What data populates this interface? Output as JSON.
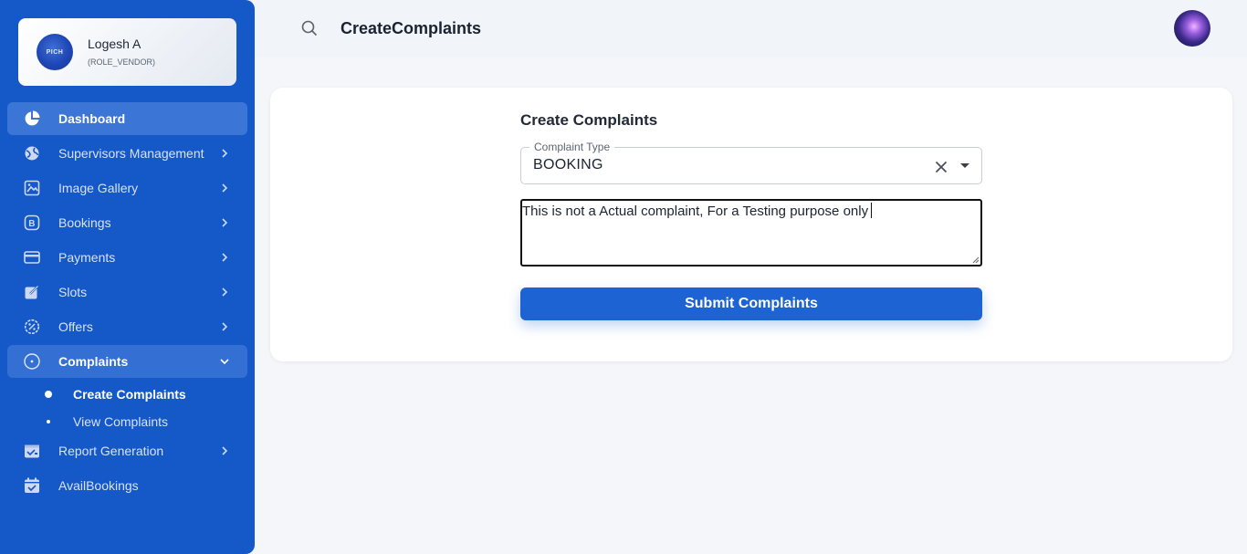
{
  "profile": {
    "name": "Logesh A",
    "role": "(ROLE_VENDOR)",
    "avatar_text": "PICH"
  },
  "sidebar": {
    "items": [
      {
        "label": "Dashboard",
        "icon": "pie-chart-icon"
      },
      {
        "label": "Supervisors Management",
        "icon": "globe-icon"
      },
      {
        "label": "Image Gallery",
        "icon": "image-gallery-icon"
      },
      {
        "label": "Bookings",
        "icon": "bookings-icon"
      },
      {
        "label": "Payments",
        "icon": "credit-card-icon"
      },
      {
        "label": "Slots",
        "icon": "edit-slot-icon"
      },
      {
        "label": "Offers",
        "icon": "discount-icon"
      },
      {
        "label": "Complaints",
        "icon": "circle-dot-icon"
      },
      {
        "label": "Report Generation",
        "icon": "report-icon"
      },
      {
        "label": "AvailBookings",
        "icon": "calendar-check-icon"
      }
    ],
    "complaints_sub": [
      {
        "label": "Create Complaints"
      },
      {
        "label": "View Complaints"
      }
    ]
  },
  "topbar": {
    "title": "CreateComplaints"
  },
  "form": {
    "heading": "Create Complaints",
    "complaint_type_label": "Complaint Type",
    "complaint_type_value": "BOOKING",
    "description_value": "This is not a Actual complaint, For a Testing purpose only",
    "submit_label": "Submit Complaints"
  },
  "colors": {
    "sidebar": "#1558c8",
    "primary_button": "#1e63d3",
    "page_bg": "#f4f6fa"
  }
}
